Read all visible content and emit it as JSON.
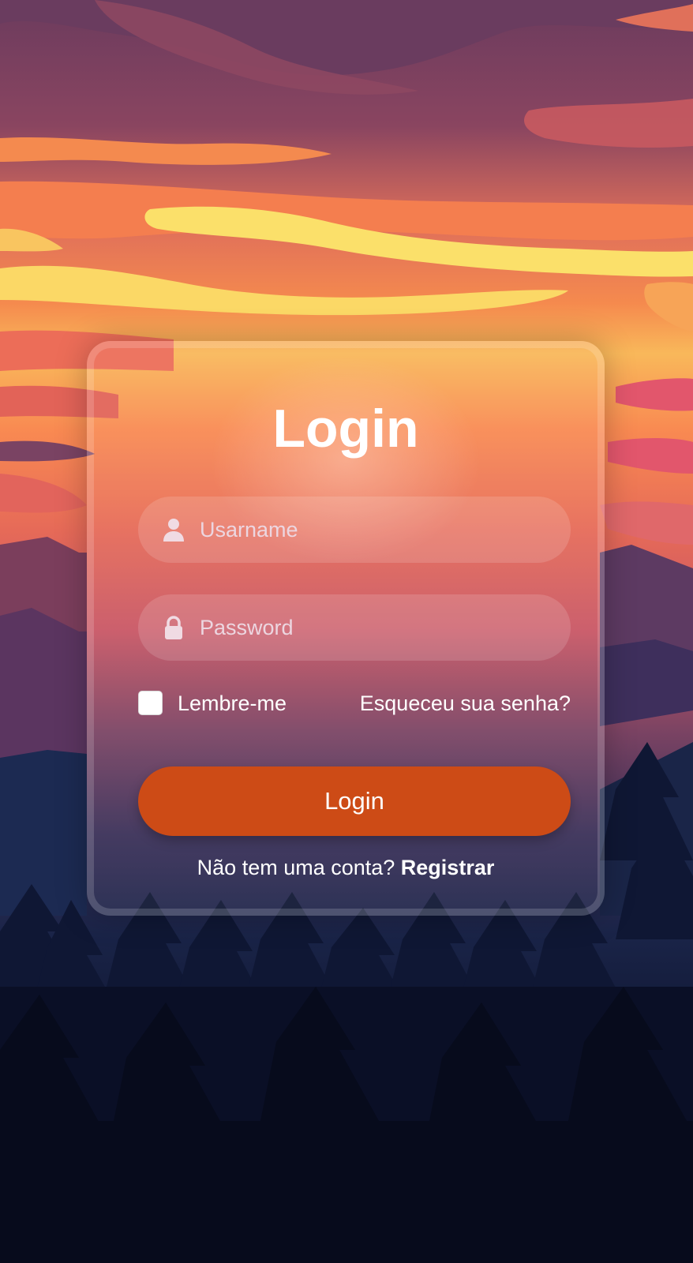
{
  "login_card": {
    "title": "Login",
    "username_placeholder": "Usarname",
    "password_placeholder": "Password",
    "remember_label": "Lembre-me",
    "forgot_link": "Esqueceu sua senha?",
    "login_button": "Login",
    "no_account_text": "Não tem uma conta?",
    "register_link": "Registrar"
  },
  "icons": {
    "username": "user-icon",
    "password": "lock-icon"
  },
  "colors": {
    "login_button": "#cd4b16",
    "text": "#ffffff"
  }
}
